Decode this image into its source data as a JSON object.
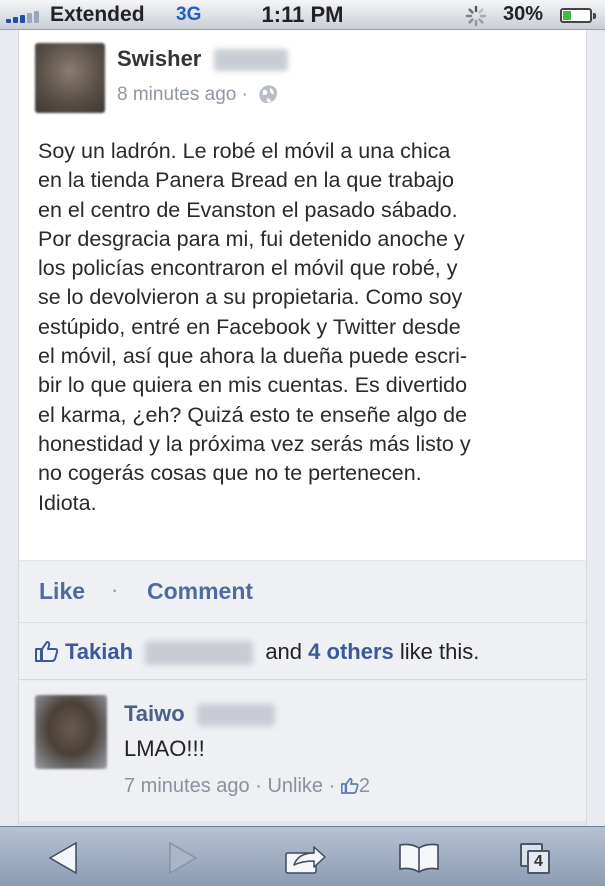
{
  "status_bar": {
    "carrier": "Extended",
    "network": "3G",
    "time": "1:11 PM",
    "battery": "30%",
    "battery_level": 0.3
  },
  "post": {
    "author": "Swisher",
    "timestamp": "8 minutes ago ·",
    "body": "Soy un ladrón. Le robé el móvil a una chica\nen la tienda Panera Bread en la que trabajo\nen el centro de Evanston el pasado sábado.\nPor desgracia para mi, fui detenido anoche y\nlos policías encontraron el móvil que robé, y\nse lo devolvieron a su propietaria. Como soy\nestúpido, entré en Facebook y Twitter desde\nel móvil, así que ahora la dueña puede escri-\nbir lo que quiera en mis cuentas. Es divertido\nel karma, ¿eh? Quizá esto te enseñe algo de\nhonestidad y la próxima vez serás más listo y\nno cogerás cosas que no te pertenecen.\nIdiota."
  },
  "actions": {
    "like": "Like",
    "separator": "·",
    "comment": "Comment"
  },
  "likes": {
    "first_name": "Takiah",
    "and": "and",
    "others": "4 others",
    "suffix": "like this."
  },
  "comment": {
    "author": "Taiwo",
    "text": "LMAO!!!",
    "timestamp": "7 minutes ago",
    "sep1": "·",
    "unlike": "Unlike",
    "sep2": "·",
    "like_count": "2"
  },
  "toolbar": {
    "tab_count": "4"
  },
  "icons": {
    "signal": "signal-bars-icon",
    "activity": "activity-spinner-icon",
    "battery": "battery-icon",
    "privacy": "globe-icon",
    "like": "thumbs-up-icon",
    "back": "back-arrow-icon",
    "forward": "forward-arrow-icon",
    "share": "share-icon",
    "bookmarks": "bookmarks-icon",
    "tabs": "tabs-icon"
  },
  "colors": {
    "facebook_blue": "#3b5998",
    "action_blue": "#4f6aa0",
    "network_blue": "#1f5fbf"
  }
}
